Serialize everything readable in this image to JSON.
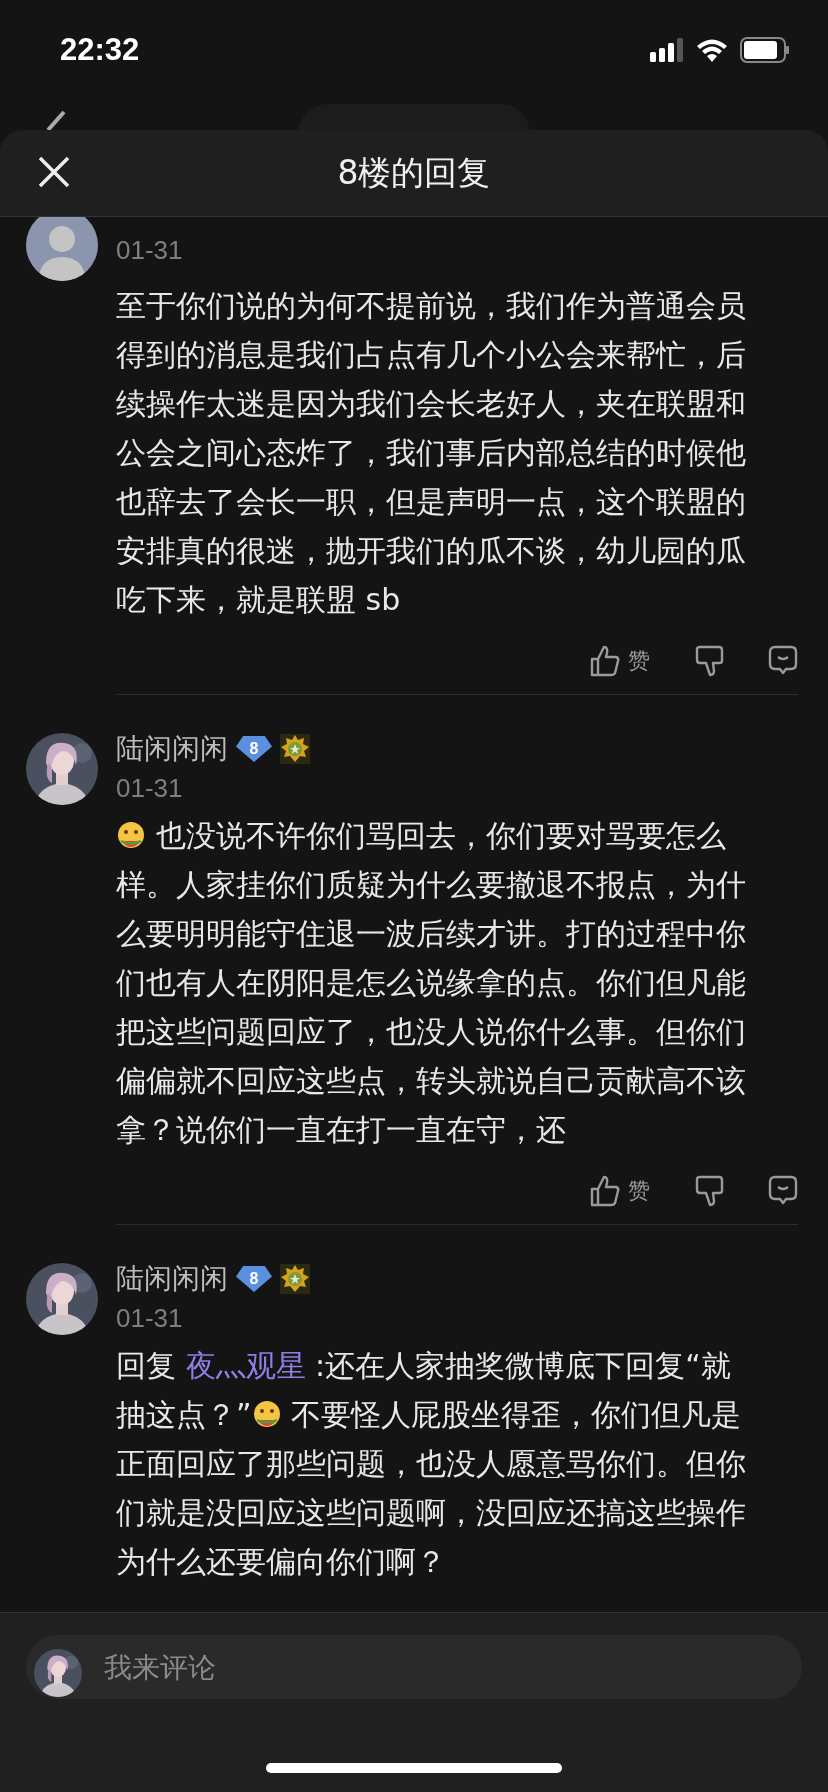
{
  "status_bar": {
    "time": "22:32"
  },
  "sheet": {
    "title": "8楼的回复"
  },
  "comments": [
    {
      "avatar": {
        "kind": "default"
      },
      "date": "01-31",
      "body": [
        {
          "kind": "text",
          "text": "至于你们说的为何不提前说，我们作为普通会员得到的消息是我们占点有几个小公会来帮忙，后续操作太迷是因为我们会长老好人，夹在联盟和公会之间心态炸了，我们事后内部总结的时候他也辞去了会长一职，但是声明一点，这个联盟的安排真的很迷，抛开我们的瓜不谈，幼儿园的瓜吃下来，就是联盟 sb"
        }
      ],
      "like_label": "赞"
    },
    {
      "avatar": {
        "kind": "picture"
      },
      "author": {
        "name": "陆闲闲闲",
        "level": "8"
      },
      "date": "01-31",
      "body": [
        {
          "kind": "emoji"
        },
        {
          "kind": "text",
          "text": " 也没说不许你们骂回去，你们要对骂要怎么样。人家挂你们质疑为什么要撤退不报点，为什么要明明能守住退一波后续才讲。打的过程中你们也有人在阴阳是怎么说缘拿的点。你们但凡能把这些问题回应了，也没人说你什么事。但你们偏偏就不回应这些点，转头就说自己贡献高不该拿？说你们一直在打一直在守，还"
        }
      ],
      "like_label": "赞"
    },
    {
      "avatar": {
        "kind": "picture"
      },
      "author": {
        "name": "陆闲闲闲",
        "level": "8"
      },
      "date": "01-31",
      "body": [
        {
          "kind": "text",
          "text": "回复 "
        },
        {
          "kind": "mention",
          "text": "夜灬观星"
        },
        {
          "kind": "text",
          "text": " :还在人家抽奖微博底下回复“就抽这点？”"
        },
        {
          "kind": "emoji"
        },
        {
          "kind": "text",
          "text": " 不要怪人屁股坐得歪，你们但凡是正面回应了那些问题，也没人愿意骂你们。但你们就是没回应这些问题啊，没回应还搞这些操作为什么还要偏向你们啊？"
        }
      ]
    }
  ],
  "composer": {
    "placeholder": "我来评论"
  }
}
